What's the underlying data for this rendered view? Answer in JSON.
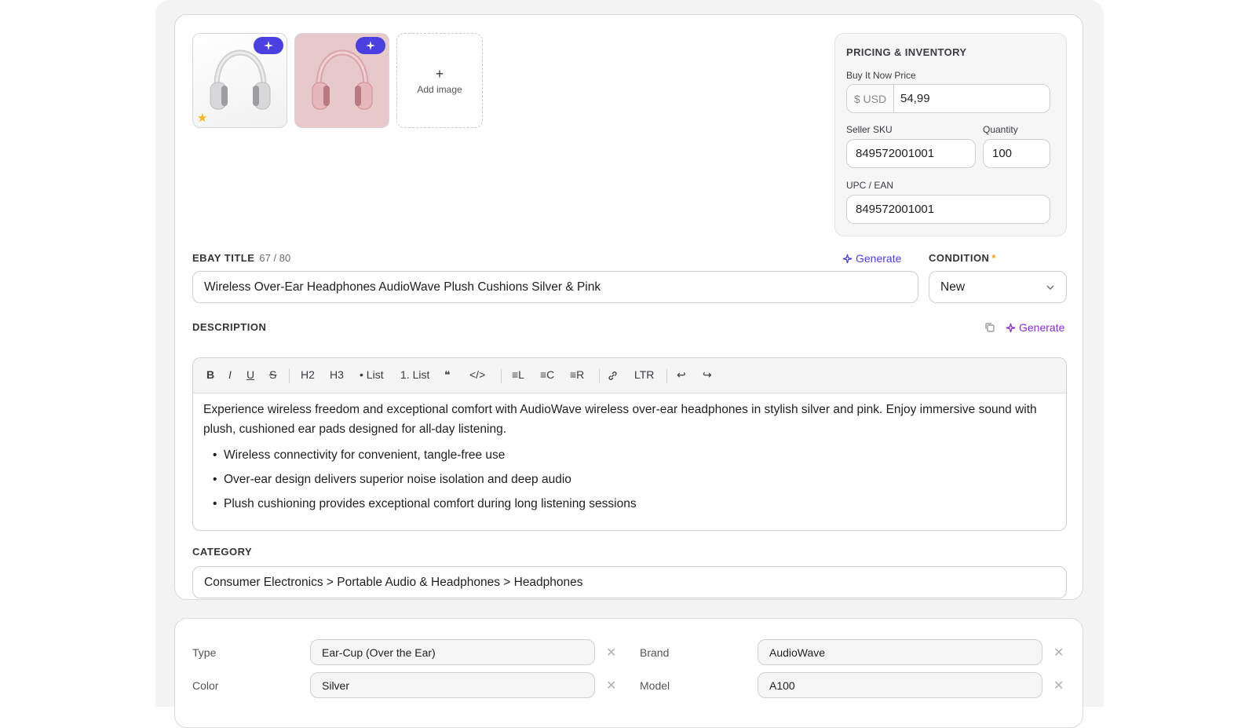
{
  "images": {
    "add_label": "Add image",
    "add_symbol": "+"
  },
  "pricing": {
    "title": "PRICING & INVENTORY",
    "price_label": "Buy It Now Price",
    "currency": "$ USD",
    "price": "54,99",
    "sku_label": "Seller SKU",
    "sku": "849572001001",
    "qty_label": "Quantity",
    "qty": "100",
    "upc_label": "UPC / EAN",
    "upc": "849572001001"
  },
  "title_section": {
    "label": "EBAY TITLE",
    "counter": "67 / 80",
    "generate": "Generate",
    "value": "Wireless Over-Ear Headphones AudioWave Plush Cushions Silver & Pink"
  },
  "condition": {
    "label": "CONDITION",
    "required": "*",
    "value": "New"
  },
  "description": {
    "label": "DESCRIPTION",
    "generate": "Generate",
    "toolbar": {
      "bold": "B",
      "italic": "I",
      "underline": "U",
      "strike": "S",
      "h2": "H2",
      "h3": "H3",
      "bullet": "• List",
      "ordered": "1. List",
      "quote": "❝",
      "code": "</>",
      "align_left": "≡L",
      "align_center": "≡C",
      "align_right": "≡R",
      "dir": "LTR",
      "undo": "↩",
      "redo": "↪"
    },
    "paragraph": "Experience wireless freedom and exceptional comfort with AudioWave wireless over-ear headphones in stylish silver and pink. Enjoy immersive sound with plush, cushioned ear pads designed for all-day listening.",
    "bullets": [
      "Wireless connectivity for convenient, tangle-free use",
      "Over-ear design delivers superior noise isolation and deep audio",
      "Plush cushioning provides exceptional comfort during long listening sessions"
    ]
  },
  "category": {
    "label": "CATEGORY",
    "value": "Consumer Electronics > Portable Audio & Headphones > Headphones"
  },
  "specifics": [
    {
      "label": "Type",
      "value": "Ear-Cup (Over the Ear)"
    },
    {
      "label": "Brand",
      "value": "AudioWave"
    },
    {
      "label": "Color",
      "value": "Silver"
    },
    {
      "label": "Model",
      "value": "A100"
    }
  ],
  "colors": {
    "accent": "#4b3fe0",
    "generate_purple": "#8a2bd1",
    "required": "#f0a020"
  }
}
